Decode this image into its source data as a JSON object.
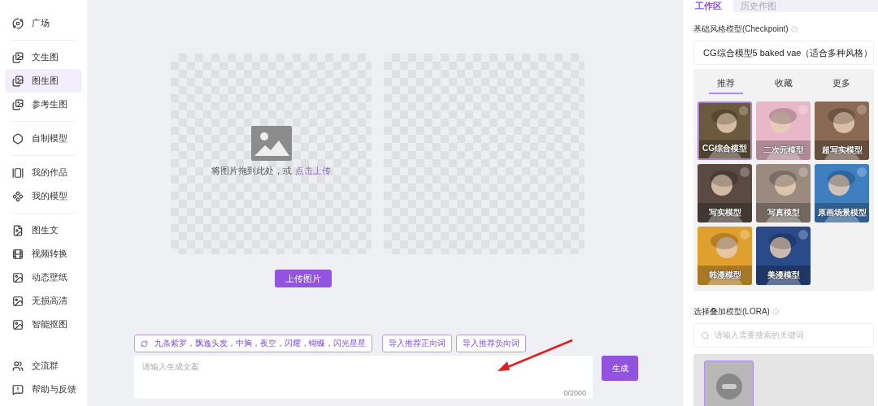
{
  "sidebar": {
    "sections": [
      {
        "items": [
          {
            "label": "广场",
            "selected": false
          }
        ]
      },
      {
        "items": [
          {
            "label": "文生图",
            "selected": false
          },
          {
            "label": "图生图",
            "selected": true
          },
          {
            "label": "参考生图",
            "selected": false
          }
        ]
      },
      {
        "items": [
          {
            "label": "自制模型",
            "selected": false
          }
        ]
      },
      {
        "items": [
          {
            "label": "我的作品",
            "selected": false
          },
          {
            "label": "我的模型",
            "selected": false
          }
        ]
      },
      {
        "items": [
          {
            "label": "图生文",
            "selected": false
          },
          {
            "label": "视频转换",
            "selected": false
          },
          {
            "label": "动态壁纸",
            "selected": false
          },
          {
            "label": "无损高清",
            "selected": false
          },
          {
            "label": "智能抠图",
            "selected": false
          }
        ]
      },
      {
        "items": [
          {
            "label": "交流群",
            "selected": false
          },
          {
            "label": "帮助与反馈",
            "selected": false
          }
        ]
      }
    ]
  },
  "upload": {
    "hint": "将图片拖到此处，或",
    "link": "点击上传",
    "button": "上传图片"
  },
  "prompt": {
    "suggestion": "九条紫罗，飘逸头发，中胸，夜空，闪耀，蝴蝶，闪光星星",
    "buttons": [
      "导入推荐正向词",
      "导入推荐负向词"
    ],
    "placeholder": "请输入生成文案",
    "counter": "0/2000",
    "generate": "生成"
  },
  "panel": {
    "tabs": [
      {
        "label": "工作区",
        "selected": true
      },
      {
        "label": "历史作图",
        "selected": false
      }
    ],
    "checkpoint_label": "基础风格模型(Checkpoint)",
    "checkpoint_value": "CG综合模型5 baked vae（适合多种风格）",
    "model_tabs": [
      {
        "label": "推荐",
        "selected": true
      },
      {
        "label": "收藏",
        "selected": false
      },
      {
        "label": "更多",
        "selected": false
      }
    ],
    "models": [
      {
        "name": "CG综合模型",
        "selected": true,
        "color": "#6b5a3e"
      },
      {
        "name": "二次元模型",
        "selected": false,
        "color": "#e8b8c8"
      },
      {
        "name": "超写实模型",
        "selected": false,
        "color": "#8a6a55"
      },
      {
        "name": "写实模型",
        "selected": false,
        "color": "#5a4a42"
      },
      {
        "name": "写真模型",
        "selected": false,
        "color": "#9a8a80"
      },
      {
        "name": "原画场景模型",
        "selected": false,
        "color": "#3f7fc0"
      },
      {
        "name": "韩漫模型",
        "selected": false,
        "color": "#e0a030"
      },
      {
        "name": "美漫模型",
        "selected": false,
        "color": "#2a4a8a"
      }
    ],
    "lora_label": "选择叠加模型(LORA)",
    "lora_placeholder": "请输入需要搜索的关键词"
  }
}
